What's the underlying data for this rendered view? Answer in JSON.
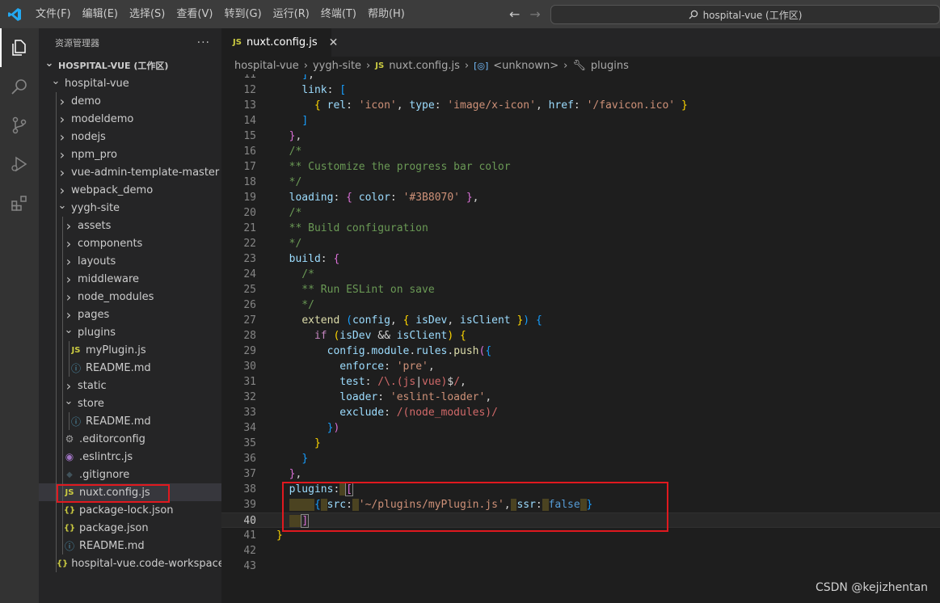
{
  "titlebar": {
    "menu": [
      "文件(F)",
      "编辑(E)",
      "选择(S)",
      "查看(V)",
      "转到(G)",
      "运行(R)",
      "终端(T)",
      "帮助(H)"
    ],
    "search_text": "hospital-vue (工作区)"
  },
  "sidebar": {
    "title": "资源管理器",
    "more": "···",
    "tree": [
      {
        "label": "HOSPITAL-VUE (工作区)",
        "depth": 0,
        "type": "root"
      },
      {
        "label": "hospital-vue",
        "depth": 1,
        "type": "open"
      },
      {
        "label": "demo",
        "depth": 2,
        "type": "closed"
      },
      {
        "label": "modeldemo",
        "depth": 2,
        "type": "closed"
      },
      {
        "label": "nodejs",
        "depth": 2,
        "type": "closed"
      },
      {
        "label": "npm_pro",
        "depth": 2,
        "type": "closed"
      },
      {
        "label": "vue-admin-template-master",
        "depth": 2,
        "type": "closed"
      },
      {
        "label": "webpack_demo",
        "depth": 2,
        "type": "closed"
      },
      {
        "label": "yygh-site",
        "depth": 2,
        "type": "open"
      },
      {
        "label": "assets",
        "depth": 3,
        "type": "closed"
      },
      {
        "label": "components",
        "depth": 3,
        "type": "closed"
      },
      {
        "label": "layouts",
        "depth": 3,
        "type": "closed"
      },
      {
        "label": "middleware",
        "depth": 3,
        "type": "closed"
      },
      {
        "label": "node_modules",
        "depth": 3,
        "type": "closed"
      },
      {
        "label": "pages",
        "depth": 3,
        "type": "closed"
      },
      {
        "label": "plugins",
        "depth": 3,
        "type": "open"
      },
      {
        "label": "myPlugin.js",
        "depth": 4,
        "type": "js"
      },
      {
        "label": "README.md",
        "depth": 4,
        "type": "info"
      },
      {
        "label": "static",
        "depth": 3,
        "type": "closed"
      },
      {
        "label": "store",
        "depth": 3,
        "type": "open"
      },
      {
        "label": "README.md",
        "depth": 4,
        "type": "info"
      },
      {
        "label": ".editorconfig",
        "depth": 3,
        "type": "gear"
      },
      {
        "label": ".eslintrc.js",
        "depth": 3,
        "type": "eslint"
      },
      {
        "label": ".gitignore",
        "depth": 3,
        "type": "git"
      },
      {
        "label": "nuxt.config.js",
        "depth": 3,
        "type": "js",
        "selected": true
      },
      {
        "label": "package-lock.json",
        "depth": 3,
        "type": "json"
      },
      {
        "label": "package.json",
        "depth": 3,
        "type": "json"
      },
      {
        "label": "README.md",
        "depth": 3,
        "type": "info"
      },
      {
        "label": "hospital-vue.code-workspace",
        "depth": 2,
        "type": "json"
      }
    ]
  },
  "editor": {
    "tab_label": "nuxt.config.js",
    "tab_badge": "JS",
    "breadcrumb": [
      "hospital-vue",
      "yygh-site",
      "nuxt.config.js",
      "<unknown>",
      "plugins"
    ],
    "current_line": "40"
  },
  "watermark": "CSDN @kejizhentan",
  "colors": {
    "highlight_border": "#e0191f",
    "accent": "#007acc"
  }
}
